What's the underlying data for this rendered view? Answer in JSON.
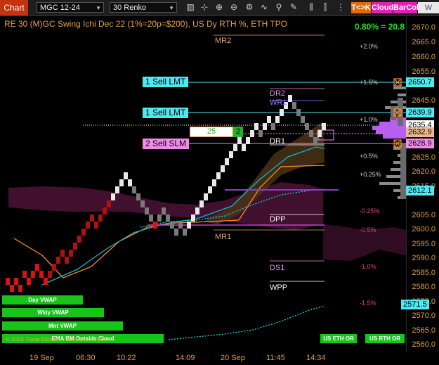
{
  "toolbar": {
    "chart_label": "Chart",
    "instrument": "MGC 12-24",
    "bar_type": "30 Renko",
    "tk_label": "T<>K",
    "cloud_label": "Cloud",
    "barcol_label": "BarCol",
    "vwap_label": "W VWA"
  },
  "header": {
    "title": "RE 30 (M)GC Swing Ichi Dec 22 (1%=20p=$200), US Dy RTH %, ETH TPO",
    "stat": "0.80% = 20.8"
  },
  "y_axis": [
    "2670.0",
    "2665.0",
    "2660.0",
    "2655.0",
    "2650.0",
    "2645.0",
    "2640.0",
    "2635.0",
    "2630.0",
    "2625.0",
    "2620.0",
    "2615.0",
    "2610.0",
    "2605.0",
    "2600.0",
    "2595.0",
    "2590.0",
    "2585.0",
    "2580.0",
    "2575.0",
    "2570.0",
    "2565.0",
    "2560.0"
  ],
  "x_axis": [
    "19 Sep",
    "06:30",
    "10:22",
    "14:09",
    "20 Sep",
    "11:45",
    "14:34"
  ],
  "price_tags": [
    {
      "label": "2650.7",
      "color": "#4fe8f0"
    },
    {
      "label": "2639.9",
      "color": "#4fe8f0"
    },
    {
      "label": "2635.4",
      "color": "#ffffff"
    },
    {
      "label": "2632.9",
      "color": "#e9b98a"
    },
    {
      "label": "2628.9",
      "color": "#f08be8"
    },
    {
      "label": "2612.1",
      "color": "#4fe8f0"
    },
    {
      "label": "2571.5",
      "color": "#4fe8f0"
    }
  ],
  "orders": [
    {
      "label": "1 Sell LMT",
      "color": "#4fe8f0"
    },
    {
      "label": "1 Sell LMT",
      "color": "#4fe8f0"
    },
    {
      "label": "2 Sell SLM",
      "color": "#f08be8"
    }
  ],
  "position": {
    "qty": "25",
    "side": "2"
  },
  "levels": [
    "MR2",
    "DR2",
    "WR1",
    "DR1",
    "DPP",
    "MR1",
    "DS1",
    "WPP"
  ],
  "pct_labels": [
    "+2.0%",
    "+1.5%",
    "+1.0%",
    "+0.5%",
    "+0.25%",
    "-0.25%",
    "-0.5%",
    "-1.0%",
    "-1.5%"
  ],
  "vwap_buttons": [
    "Day VWAP",
    "Wkly VWAP",
    "Mnt VWAP",
    "EMA BM Outside Cloud"
  ],
  "session_buttons": [
    "US ETH OR",
    "US RTH OR"
  ],
  "bottom_note": "© 2024 Trade Kitchen...  www.tk-... .com",
  "colors": {
    "accent": "#c4320f",
    "cyan": "#4fe8f0",
    "magenta": "#f08be8",
    "green": "#18c418",
    "axis": "#e0a040"
  }
}
